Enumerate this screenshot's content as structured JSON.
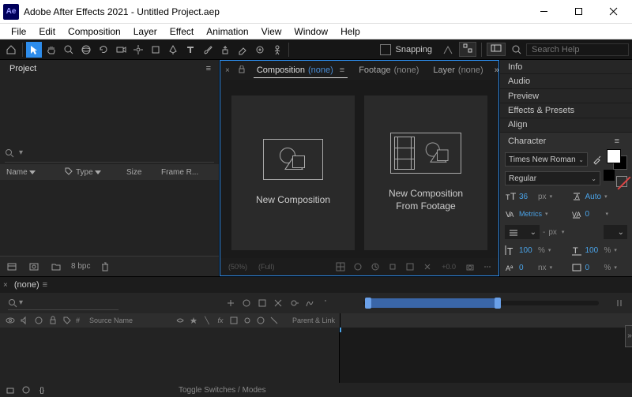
{
  "app": {
    "logo": "Ae",
    "title": "Adobe After Effects 2021 - Untitled Project.aep"
  },
  "menu": {
    "items": [
      "File",
      "Edit",
      "Composition",
      "Layer",
      "Effect",
      "Animation",
      "View",
      "Window",
      "Help"
    ]
  },
  "toolbar": {
    "snapping_label": "Snapping",
    "search_placeholder": "Search Help"
  },
  "project": {
    "tab": "Project",
    "columns": {
      "name": "Name",
      "type": "Type",
      "size": "Size",
      "framerate": "Frame R..."
    },
    "bpc": "8 bpc"
  },
  "comp": {
    "tabs": {
      "composition": {
        "label": "Composition",
        "sub": "(none)"
      },
      "footage": {
        "label": "Footage",
        "sub": "(none)"
      },
      "layer": {
        "label": "Layer",
        "sub": "(none)"
      }
    },
    "card1": "New Composition",
    "card2": "New Composition\nFrom Footage",
    "footer": {
      "pct": "(50%)",
      "full": "(Full)",
      "zoom": "+0.0"
    }
  },
  "right": {
    "panels": [
      "Info",
      "Audio",
      "Preview",
      "Effects & Presets",
      "Align"
    ],
    "character_label": "Character"
  },
  "character": {
    "font": "Times New Roman",
    "style": "Regular",
    "size": "36",
    "size_unit": "px",
    "leading": "Auto",
    "kerning": "Metrics",
    "tracking": "0",
    "px_dash": "px",
    "dash": "-",
    "vscale": "100",
    "vscale_unit": "%",
    "hscale": "100",
    "hscale_unit": "%",
    "baseline": "0",
    "baseline_unit": "nx",
    "tsume": "0",
    "tsume_unit": "%"
  },
  "timeline": {
    "tab": "(none)",
    "col_num": "#",
    "col_source": "Source Name",
    "col_parent": "Parent & Link",
    "toggle": "Toggle Switches / Modes"
  }
}
